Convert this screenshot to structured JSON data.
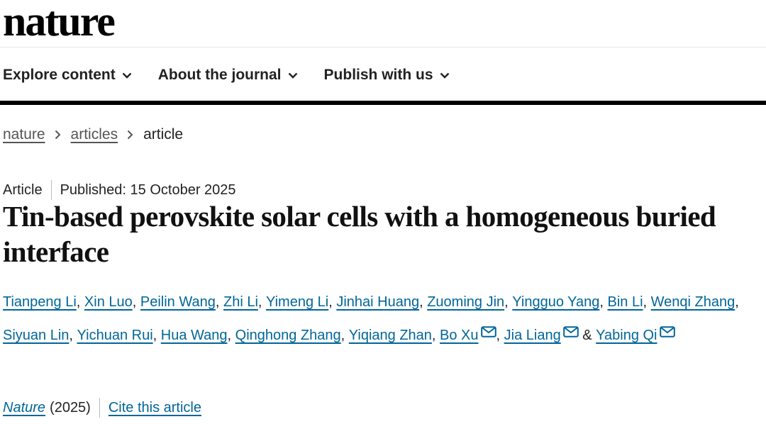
{
  "header": {
    "logo": "nature",
    "nav": [
      {
        "label": "Explore content",
        "icon": "chevron-down-icon"
      },
      {
        "label": "About the journal",
        "icon": "chevron-down-icon"
      },
      {
        "label": "Publish with us",
        "icon": "chevron-down-icon"
      }
    ]
  },
  "breadcrumb": {
    "items": [
      "nature",
      "articles",
      "article"
    ],
    "separator_icon": "chevron-right-icon"
  },
  "article": {
    "type": "Article",
    "published": "Published: 15 October 2025",
    "title": "Tin-based perovskite solar cells with a homogeneous buried interface",
    "authors": [
      {
        "name": "Tianpeng Li",
        "sep": ", "
      },
      {
        "name": "Xin Luo",
        "sep": ", "
      },
      {
        "name": "Peilin Wang",
        "sep": ", "
      },
      {
        "name": "Zhi Li",
        "sep": ", "
      },
      {
        "name": "Yimeng Li",
        "sep": ", "
      },
      {
        "name": "Jinhai Huang",
        "sep": ", "
      },
      {
        "name": "Zuoming Jin",
        "sep": ", "
      },
      {
        "name": "Yingguo Yang",
        "sep": ", "
      },
      {
        "name": "Bin Li",
        "sep": ", "
      },
      {
        "name": "Wenqi Zhang",
        "sep": ", "
      },
      {
        "name": "Siyuan Lin",
        "sep": ", "
      },
      {
        "name": "Yichuan Rui",
        "sep": ", "
      },
      {
        "name": "Hua Wang",
        "sep": ", "
      },
      {
        "name": "Qinghong Zhang",
        "sep": ", "
      },
      {
        "name": "Yiqiang Zhan",
        "sep": ", "
      },
      {
        "name": "Bo Xu",
        "sep": ", ",
        "mail": true
      },
      {
        "name": "Jia Liang",
        "sep": " & ",
        "mail": true
      },
      {
        "name": "Yabing Qi",
        "sep": "",
        "mail": true
      }
    ],
    "journal": "Nature",
    "year": "(2025)",
    "cite_label": "Cite this article"
  },
  "colors": {
    "link": "#006699",
    "text": "#222222",
    "rule": "#000000"
  }
}
